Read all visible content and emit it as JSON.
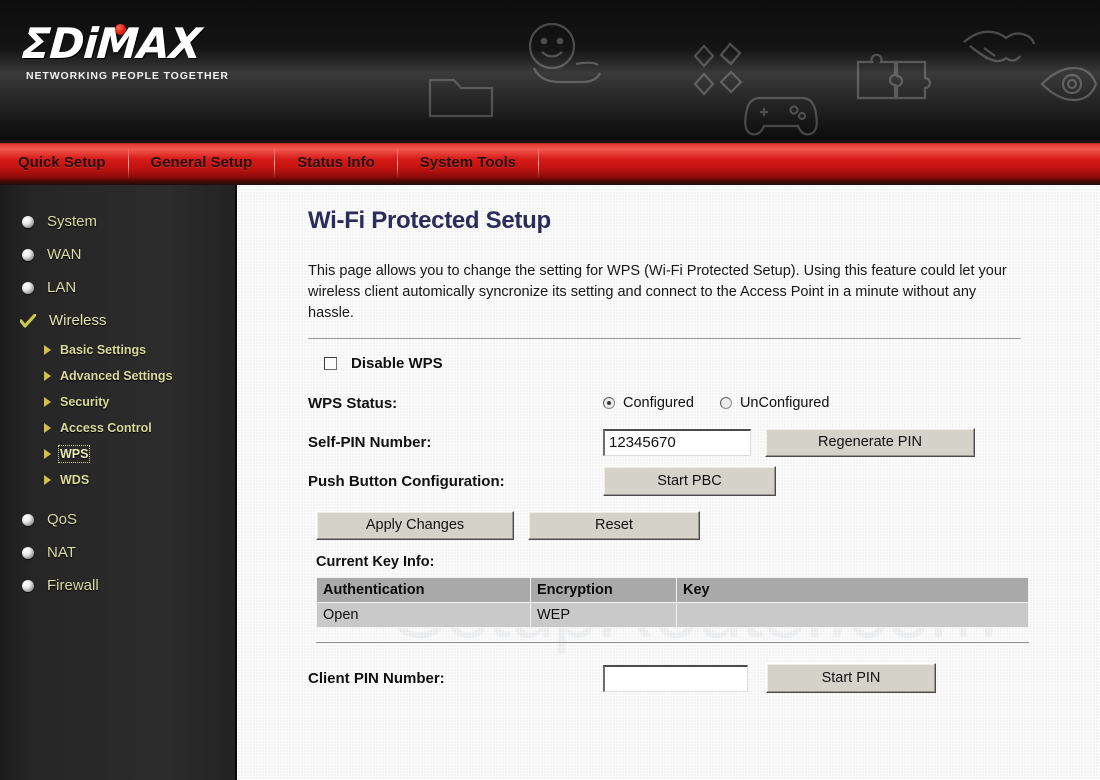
{
  "brand": {
    "logo_text": "ΣDiMAX",
    "tagline": "NETWORKING PEOPLE TOGETHER",
    "accent_red": "#d71b18",
    "header_bg": "#1a1a1a"
  },
  "header_icons": [
    {
      "name": "smiley-in-hand-icon"
    },
    {
      "name": "folder-icon"
    },
    {
      "name": "diamonds-icon"
    },
    {
      "name": "gamepad-icon"
    },
    {
      "name": "puzzle-icon"
    },
    {
      "name": "handshake-icon"
    },
    {
      "name": "eye-icon"
    }
  ],
  "navbar": {
    "items": [
      {
        "label": "Quick Setup"
      },
      {
        "label": "General Setup"
      },
      {
        "label": "Status Info"
      },
      {
        "label": "System Tools"
      }
    ]
  },
  "sidebar": {
    "items": [
      {
        "label": "System",
        "icon": "bullet-sphere-icon",
        "active": false
      },
      {
        "label": "WAN",
        "icon": "bullet-sphere-icon",
        "active": false
      },
      {
        "label": "LAN",
        "icon": "bullet-sphere-icon",
        "active": false
      },
      {
        "label": "Wireless",
        "icon": "checkmark-icon",
        "active": true
      },
      {
        "label": "QoS",
        "icon": "bullet-sphere-icon",
        "active": false
      },
      {
        "label": "NAT",
        "icon": "bullet-sphere-icon",
        "active": false
      },
      {
        "label": "Firewall",
        "icon": "bullet-sphere-icon",
        "active": false
      }
    ],
    "wireless_subitems": [
      {
        "label": "Basic Settings",
        "selected": false
      },
      {
        "label": "Advanced Settings",
        "selected": false
      },
      {
        "label": "Security",
        "selected": false
      },
      {
        "label": "Access Control",
        "selected": false
      },
      {
        "label": "WPS",
        "selected": true
      },
      {
        "label": "WDS",
        "selected": false
      }
    ]
  },
  "main": {
    "title": "Wi-Fi Protected Setup",
    "description": "This page allows you to change the setting for WPS (Wi-Fi Protected Setup). Using this feature could let your wireless client automically syncronize its setting and connect to the Access Point in a minute without any hassle.",
    "watermark": "SetupRouter.com",
    "disable_wps": {
      "label": "Disable WPS",
      "checked": false
    },
    "wps_status": {
      "label": "WPS Status:",
      "options": [
        {
          "label": "Configured",
          "selected": true
        },
        {
          "label": "UnConfigured",
          "selected": false
        }
      ]
    },
    "self_pin": {
      "label": "Self-PIN Number:",
      "value": "12345670",
      "placeholder": "",
      "button_label": "Regenerate PIN"
    },
    "push_button": {
      "label": "Push Button Configuration:",
      "button_label": "Start PBC"
    },
    "form_buttons": {
      "apply_label": "Apply Changes",
      "reset_label": "Reset"
    },
    "current_key_info": {
      "heading": "Current Key Info:",
      "columns": [
        "Authentication",
        "Encryption",
        "Key"
      ],
      "rows": [
        [
          "Open",
          "WEP",
          ""
        ]
      ]
    },
    "client_pin": {
      "label": "Client PIN Number:",
      "value": "",
      "placeholder": "",
      "button_label": "Start PIN"
    }
  }
}
